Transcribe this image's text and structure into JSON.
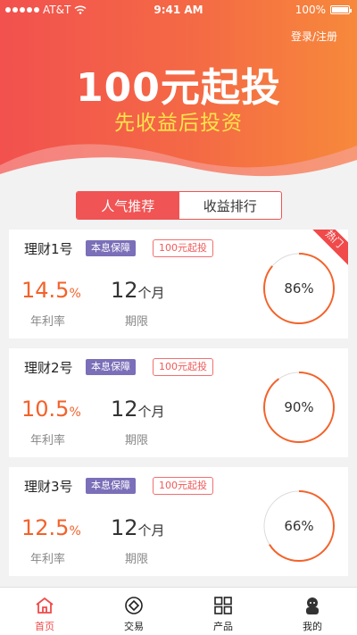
{
  "status_bar": {
    "carrier": "AT&T",
    "time": "9:41 AM",
    "battery": "100%"
  },
  "header": {
    "login": "登录/注册",
    "title": "100元起投",
    "subtitle": "先收益后投资"
  },
  "segments": [
    {
      "label": "人气推荐",
      "active": true
    },
    {
      "label": "收益排行",
      "active": false
    }
  ],
  "products": [
    {
      "name": "理财1号",
      "tag_guarantee": "本息保障",
      "tag_min": "100元起投",
      "rate": "14.5",
      "rate_unit": "%",
      "rate_label": "年利率",
      "term": "12",
      "term_unit": "个月",
      "term_label": "期限",
      "progress": "86%",
      "progress_value": 86,
      "hot": "热门"
    },
    {
      "name": "理财2号",
      "tag_guarantee": "本息保障",
      "tag_min": "100元起投",
      "rate": "10.5",
      "rate_unit": "%",
      "rate_label": "年利率",
      "term": "12",
      "term_unit": "个月",
      "term_label": "期限",
      "progress": "90%",
      "progress_value": 90
    },
    {
      "name": "理财3号",
      "tag_guarantee": "本息保障",
      "tag_min": "100元起投",
      "rate": "12.5",
      "rate_unit": "%",
      "rate_label": "年利率",
      "term": "12",
      "term_unit": "个月",
      "term_label": "期限",
      "progress": "66%",
      "progress_value": 66
    }
  ],
  "tabbar": [
    {
      "label": "首页",
      "icon": "home-icon",
      "active": true
    },
    {
      "label": "交易",
      "icon": "trade-icon",
      "active": false
    },
    {
      "label": "产品",
      "icon": "grid-icon",
      "active": false
    },
    {
      "label": "我的",
      "icon": "user-icon",
      "active": false
    }
  ],
  "colors": {
    "primary": "#f05454",
    "rate": "#f3622a",
    "ring": "#f3622a",
    "tag_guarantee": "#7a6fb8",
    "highlight": "#ffe44a"
  }
}
